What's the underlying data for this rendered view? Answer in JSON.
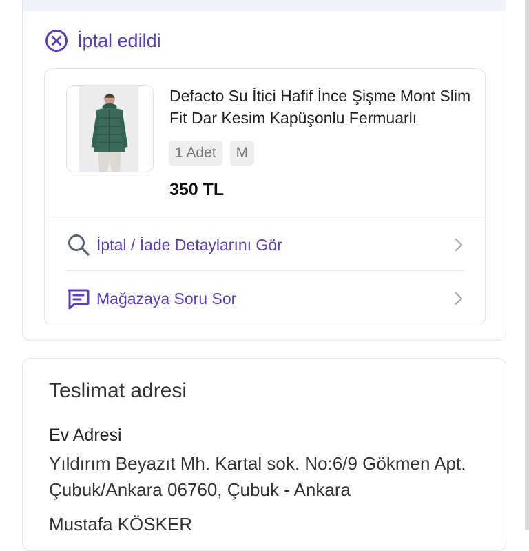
{
  "order": {
    "status_text": "İptal edildi",
    "status_icon": "cancel-circle-icon",
    "accent_color": "#5b3cc4",
    "item": {
      "image_icon": "product-jacket-photo",
      "title": "Defacto Su İtici Hafif İnce Şişme Mont Slim Fit Dar Kesim Kapüşonlu Fermuarlı",
      "quantity_label": "1 Adet",
      "size_label": "M",
      "price": "350 TL"
    },
    "actions": [
      {
        "label": "İptal / İade Detaylarını Gör",
        "icon": "search-icon"
      },
      {
        "label": "Mağazaya Soru Sor",
        "icon": "chat-message-icon"
      }
    ]
  },
  "address": {
    "heading": "Teslimat adresi",
    "type": "Ev Adresi",
    "line": "Yıldırım Beyazıt Mh.  Kartal sok. No:6/9 Gökmen Apt. Çubuk/Ankara 06760, Çubuk - Ankara",
    "recipient": "Mustafa KÖSKER"
  }
}
